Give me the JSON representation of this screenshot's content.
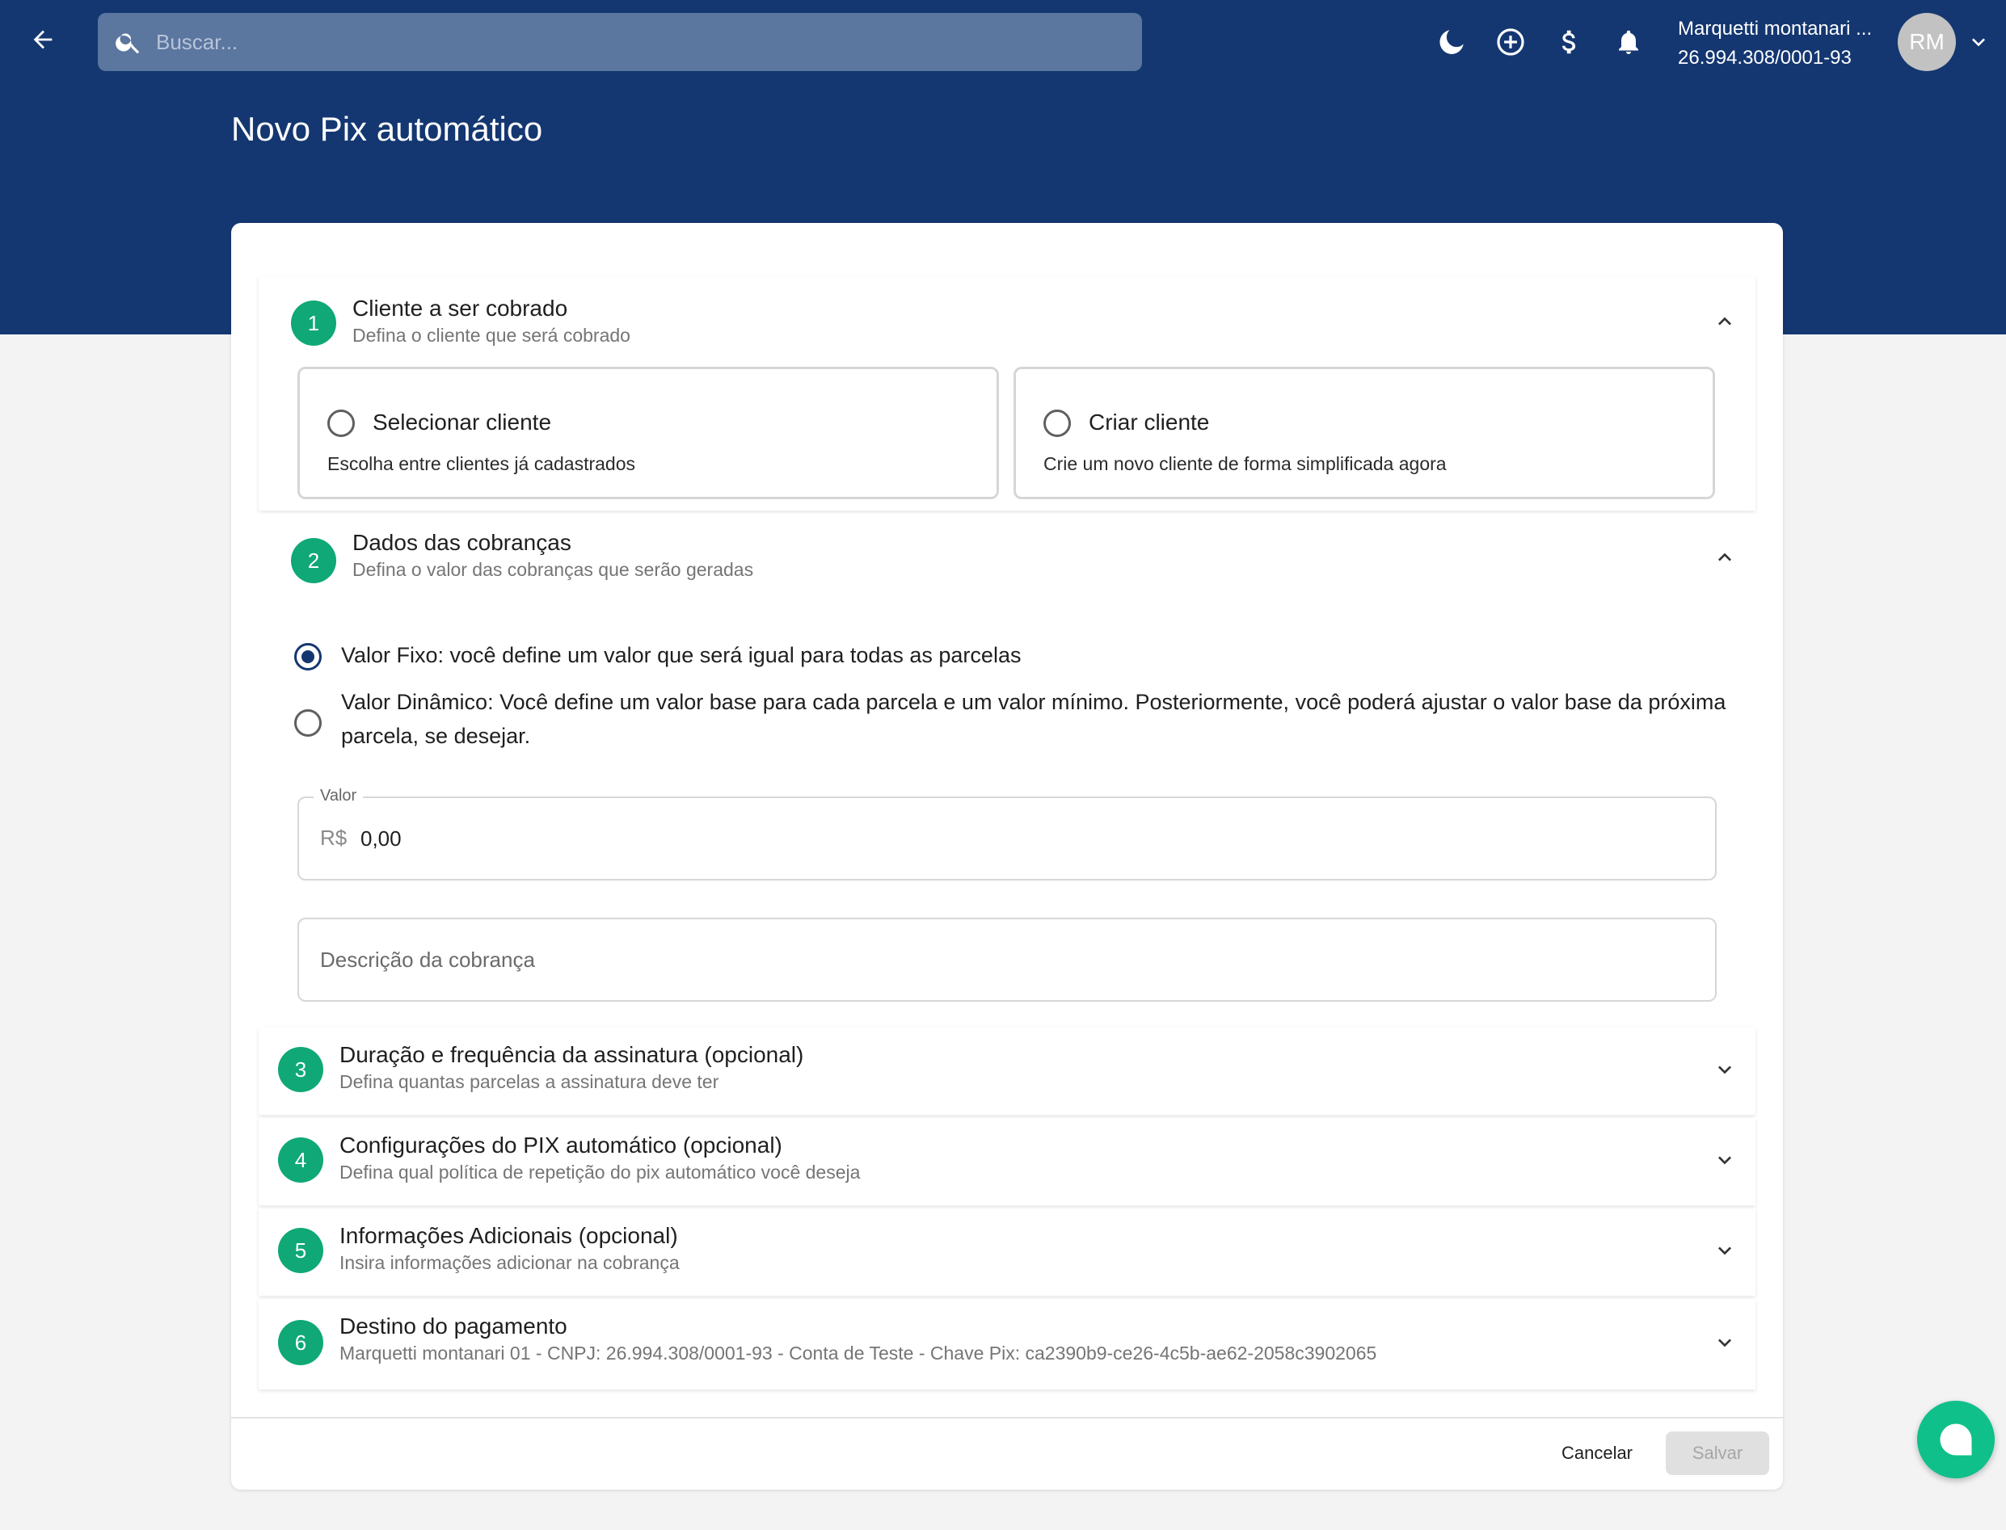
{
  "header": {
    "search_placeholder": "Buscar...",
    "user_name": "Marquetti montanari ...",
    "user_doc": "26.994.308/0001-93",
    "avatar_initials": "RM",
    "icons": [
      "arrow-left-icon",
      "search-icon",
      "moon-icon",
      "plus-circle-icon",
      "dollar-icon",
      "bell-icon",
      "chevron-down-icon"
    ]
  },
  "page": {
    "title": "Novo Pix automático"
  },
  "sections": {
    "s1": {
      "number": "1",
      "title": "Cliente a ser cobrado",
      "subtitle": "Defina o cliente que será cobrado",
      "options": [
        {
          "title": "Selecionar cliente",
          "desc": "Escolha entre clientes já cadastrados"
        },
        {
          "title": "Criar cliente",
          "desc": "Crie um novo cliente de forma simplificada agora"
        }
      ]
    },
    "s2": {
      "number": "2",
      "title": "Dados das cobranças",
      "subtitle": "Defina o valor das cobranças que serão geradas",
      "radio_fixed": "Valor Fixo: você define um valor que será igual para todas as parcelas",
      "radio_dynamic": "Valor Dinâmico: Você define um valor base para cada parcela e um valor mínimo. Posteriormente, você poderá ajustar o valor base da próxima parcela, se desejar.",
      "selected": "fixed",
      "valor_label": "Valor",
      "valor_prefix": "R$",
      "valor_value": "0,00",
      "descricao_placeholder": "Descrição da cobrança"
    },
    "s3": {
      "number": "3",
      "title": "Duração e frequência da assinatura (opcional)",
      "subtitle": "Defina quantas parcelas a assinatura deve ter"
    },
    "s4": {
      "number": "4",
      "title": "Configurações do PIX automático (opcional)",
      "subtitle": "Defina qual política de repetição do pix automático você deseja"
    },
    "s5": {
      "number": "5",
      "title": "Informações Adicionais (opcional)",
      "subtitle": "Insira informações adicionar na cobrança"
    },
    "s6": {
      "number": "6",
      "title": "Destino do pagamento",
      "subtitle": "Marquetti montanari 01 - CNPJ: 26.994.308/0001-93 - Conta de Teste - Chave Pix: ca2390b9-ce26-4c5b-ae62-2058c3902065"
    }
  },
  "footer": {
    "cancel_label": "Cancelar",
    "save_label": "Salvar"
  },
  "colors": {
    "header_bg": "#143771",
    "step_badge": "#0fa876",
    "chat_fab": "#0fc08a",
    "page_bg": "#f3f3f4"
  }
}
